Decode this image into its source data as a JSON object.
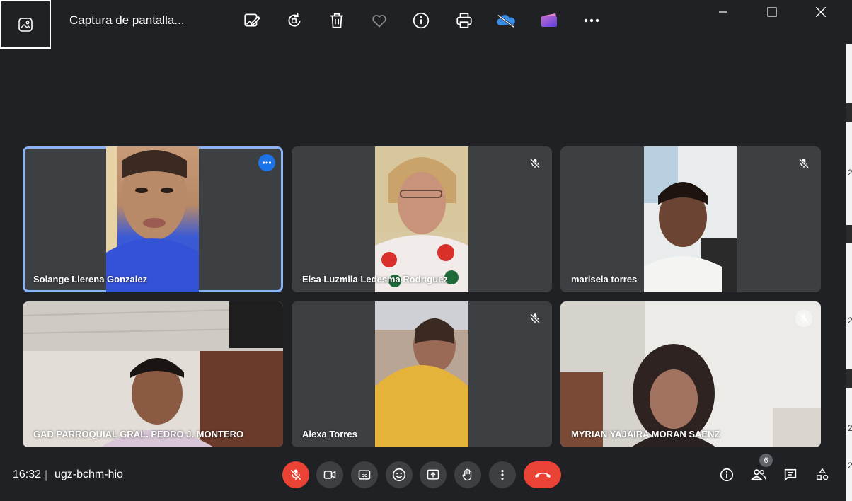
{
  "window": {
    "title": "Captura de pantalla...",
    "toolbar_icons": [
      "edit-image-icon",
      "rotate-icon",
      "delete-icon",
      "favorite-heart-icon",
      "info-icon",
      "print-icon",
      "onedrive-icon",
      "video-editor-icon",
      "more-icon"
    ],
    "controls": [
      "minimize-icon",
      "maximize-icon",
      "close-icon"
    ]
  },
  "meeting": {
    "time": "16:32",
    "separator": "|",
    "code": "ugz-bchm-hio",
    "participants_count": "6",
    "mic_state": "off",
    "colors": {
      "background": "#202124",
      "tile": "#3c4043",
      "active_border": "#8ab4f8",
      "danger": "#ea4335",
      "accent": "#1a73e8"
    }
  },
  "participants": [
    {
      "name": "Solange Llerena Gonzalez",
      "muted": false,
      "active": true,
      "indicator": "more-options-icon"
    },
    {
      "name": "Elsa Luzmila Ledesma Rodriguez",
      "muted": true
    },
    {
      "name": "marisela torres",
      "muted": true
    },
    {
      "name": "GAD PARROQUIAL GRAL. PEDRO J. MONTERO",
      "muted": false
    },
    {
      "name": "Alexa Torres",
      "muted": true
    },
    {
      "name": "MYRIAN YAJAIRA MORAN SAENZ",
      "muted": true
    }
  ],
  "controls_bar": {
    "center": [
      "mic-off-icon",
      "camera-icon",
      "captions-icon",
      "emoji-icon",
      "present-screen-icon",
      "raise-hand-icon",
      "more-vert-icon",
      "end-call-icon"
    ],
    "right": [
      "meeting-info-icon",
      "people-icon",
      "chat-icon",
      "activities-icon"
    ]
  },
  "right_strip_text": [
    "2",
    "2",
    "2",
    "2"
  ]
}
